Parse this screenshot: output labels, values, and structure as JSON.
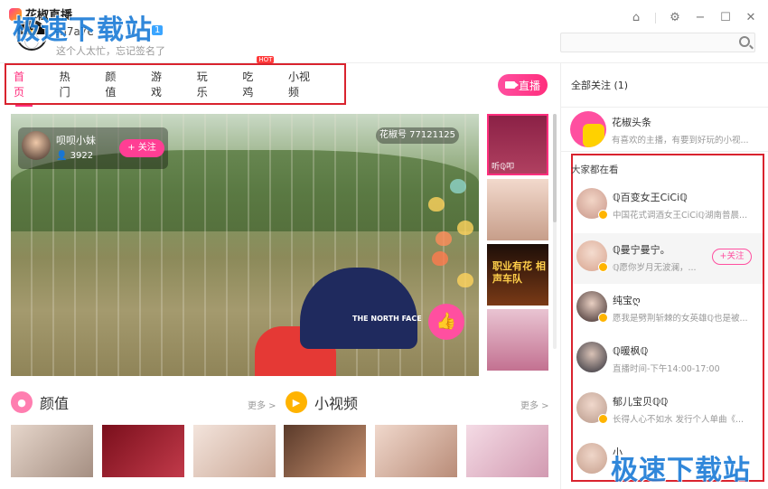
{
  "app": {
    "name": "花椒直播"
  },
  "watermark": "极速下载站",
  "user": {
    "name": "sh7a7e",
    "level": "1",
    "signature": "这个人太忙，忘记签名了"
  },
  "search": {
    "placeholder": ""
  },
  "nav": {
    "tabs": [
      {
        "label": "首页",
        "active": true
      },
      {
        "label": "热门"
      },
      {
        "label": "颜值"
      },
      {
        "label": "游戏"
      },
      {
        "label": "玩乐"
      },
      {
        "label": "吃鸡",
        "badge": "HOT"
      },
      {
        "label": "小视频"
      }
    ],
    "live_label": "直播"
  },
  "player": {
    "host_name": "呗呗小妹",
    "host_fans": "3922",
    "follow_label": "+ 关注",
    "room_id": "花椒号 77121125",
    "cap_text": "THE NORTH FACE"
  },
  "thumbs": [
    {
      "label": "听ℚ叩",
      "color": "#8b2146"
    },
    {
      "label": "",
      "color": "#e7c7b4"
    },
    {
      "label": "职业有花 相声车队",
      "color": "#3b1e12"
    },
    {
      "label": "",
      "color": "#d59ab0"
    }
  ],
  "sections": [
    {
      "title": "颜值",
      "more": "更多 >",
      "icon_color": "#ff7eb0"
    },
    {
      "title": "小视频",
      "more": "更多 >",
      "icon_color": "#ffb300"
    }
  ],
  "tiles": [
    "#c6b4a6",
    "#a11b2a",
    "#e4cfc3",
    "#6f4a35",
    "#d9b7a4",
    "#e8c6d6"
  ],
  "right_panel": {
    "follow_all": "全部关注 (1)",
    "headline": {
      "title": "花椒头条",
      "sub": "有喜欢的主播，有要到好玩的小视..."
    },
    "watching_title": "大家都在看",
    "items": [
      {
        "name": "ℚ百变女王CiCiℚ",
        "desc": "中国花式调酒女王CiCiℚ湖南普晨...",
        "color": "#c9978a"
      },
      {
        "name": "ℚ曼宁曼宁。",
        "desc": "ℚ愿你岁月无波澜，...",
        "follow": "+关注",
        "color": "#d8a48f"
      },
      {
        "name": "纯宝ღ",
        "desc": "愿我是劈荆斩棘的女英雄ℚ也是被...",
        "color": "#3b2a2a"
      },
      {
        "name": "ℚ暖枫ℚ",
        "desc": "直播时间-下午14:00-17:00",
        "color": "#2e2e38"
      },
      {
        "name": "郁儿宝贝ℚℚ",
        "desc": "长得人心不如水 发行个人单曲《...",
        "color": "#b99a8b"
      },
      {
        "name": "小",
        "desc": "",
        "color": "#c7a08e"
      }
    ]
  }
}
